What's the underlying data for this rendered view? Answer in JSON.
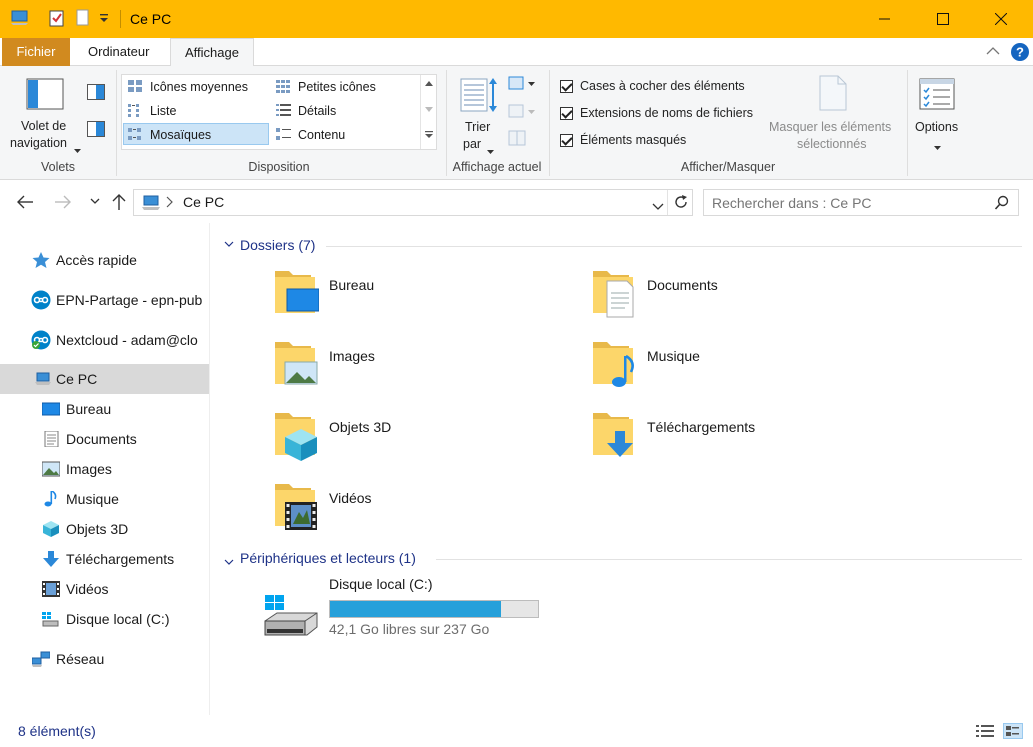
{
  "window": {
    "title": "Ce PC"
  },
  "tabs": {
    "file": "Fichier",
    "computer": "Ordinateur",
    "view": "Affichage"
  },
  "ribbon": {
    "panes": {
      "nav_pane_line1": "Volet de",
      "nav_pane_line2": "navigation",
      "group_label": "Volets"
    },
    "layout": {
      "group_label": "Disposition",
      "items": [
        "Icônes moyennes",
        "Petites icônes",
        "Liste",
        "Détails",
        "Mosaïques",
        "Contenu"
      ],
      "selected": "Mosaïques"
    },
    "current_view": {
      "sort_line1": "Trier",
      "sort_line2": "par",
      "group_label": "Affichage actuel"
    },
    "show_hide": {
      "group_label": "Afficher/Masquer",
      "checkboxes": [
        "Cases à cocher des éléments",
        "Extensions de noms de fichiers",
        "Éléments masqués"
      ],
      "hide_selected_line1": "Masquer les éléments",
      "hide_selected_line2": "sélectionnés"
    },
    "options_label": "Options"
  },
  "address": {
    "path": "Ce PC",
    "search_placeholder": "Rechercher dans : Ce PC"
  },
  "sidebar": {
    "items": [
      {
        "label": "Accès rapide",
        "icon": "star-icon"
      },
      {
        "label": "EPN-Partage - epn-pub",
        "icon": "cloud-sync-icon"
      },
      {
        "label": "Nextcloud - adam@clo",
        "icon": "cloud-sync-icon"
      },
      {
        "label": "Ce PC",
        "icon": "computer-icon"
      },
      {
        "label": "Bureau",
        "icon": "desktop-icon"
      },
      {
        "label": "Documents",
        "icon": "document-icon"
      },
      {
        "label": "Images",
        "icon": "image-icon"
      },
      {
        "label": "Musique",
        "icon": "music-icon"
      },
      {
        "label": "Objets 3D",
        "icon": "cube-icon"
      },
      {
        "label": "Téléchargements",
        "icon": "download-icon"
      },
      {
        "label": "Vidéos",
        "icon": "video-icon"
      },
      {
        "label": "Disque local (C:)",
        "icon": "drive-icon"
      },
      {
        "label": "Réseau",
        "icon": "network-icon"
      }
    ]
  },
  "content": {
    "folders_header": "Dossiers (7)",
    "folders": [
      "Bureau",
      "Documents",
      "Images",
      "Musique",
      "Objets 3D",
      "Téléchargements",
      "Vidéos"
    ],
    "devices_header": "Périphériques et lecteurs (1)",
    "drive": {
      "name": "Disque local (C:)",
      "free_text": "42,1 Go libres sur 237 Go",
      "used_fraction": 0.82
    }
  },
  "status": {
    "count": "8 élément(s)"
  },
  "colors": {
    "titlebar": "#ffb900",
    "accent": "#26a0da",
    "header_text": "#1e3287"
  }
}
